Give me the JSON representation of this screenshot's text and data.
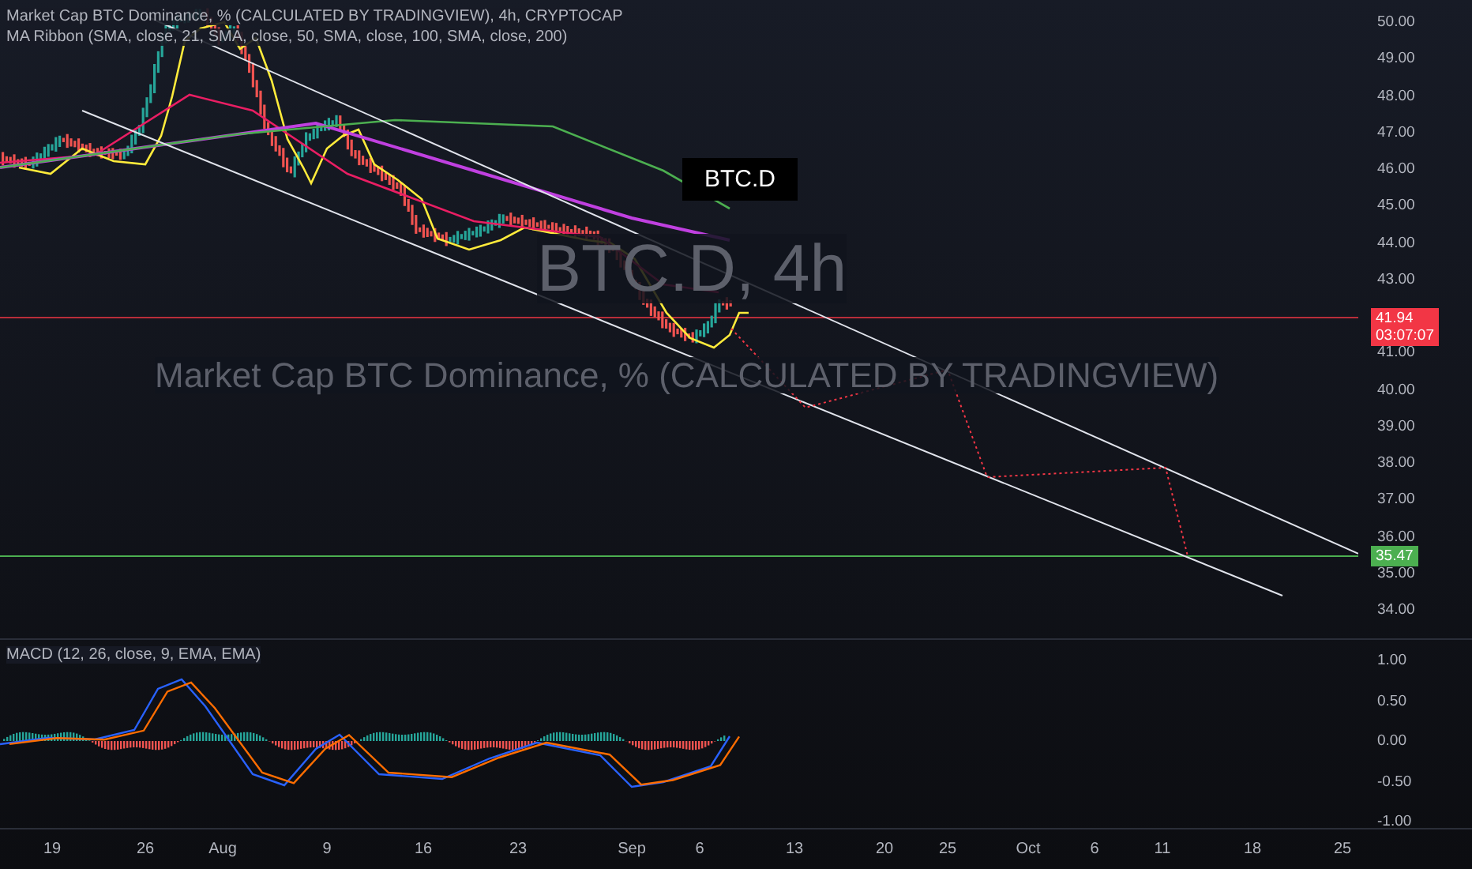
{
  "header": {
    "title": "Market Cap BTC Dominance, % (CALCULATED BY TRADINGVIEW), 4h, CRYPTOCAP",
    "indicator": "MA Ribbon (SMA, close, 21, SMA, close, 50, SMA, close, 100, SMA, close, 200)"
  },
  "watermark": {
    "symbol": "BTC.D, 4h",
    "description": "Market Cap BTC Dominance, % (CALCULATED BY TRADINGVIEW)"
  },
  "label_box": "BTC.D",
  "price_axis": {
    "ticks": [
      "50.00",
      "49.00",
      "48.00",
      "47.00",
      "46.00",
      "45.00",
      "44.00",
      "43.00",
      "41.00",
      "40.00",
      "39.00",
      "38.00",
      "37.00",
      "36.00",
      "35.00",
      "34.00"
    ],
    "last_price": {
      "value": "41.94",
      "countdown": "03:07:07"
    },
    "level_marker": "35.47"
  },
  "macd": {
    "title": "MACD (12, 26, close, 9, EMA, EMA)",
    "ticks": [
      "1.00",
      "0.50",
      "0.00",
      "-0.50",
      "-1.00"
    ]
  },
  "time_axis": {
    "labels": [
      "19",
      "26",
      "Aug",
      "9",
      "16",
      "23",
      "Sep",
      "6",
      "13",
      "20",
      "25",
      "Oct",
      "6",
      "11",
      "18",
      "25"
    ]
  }
}
